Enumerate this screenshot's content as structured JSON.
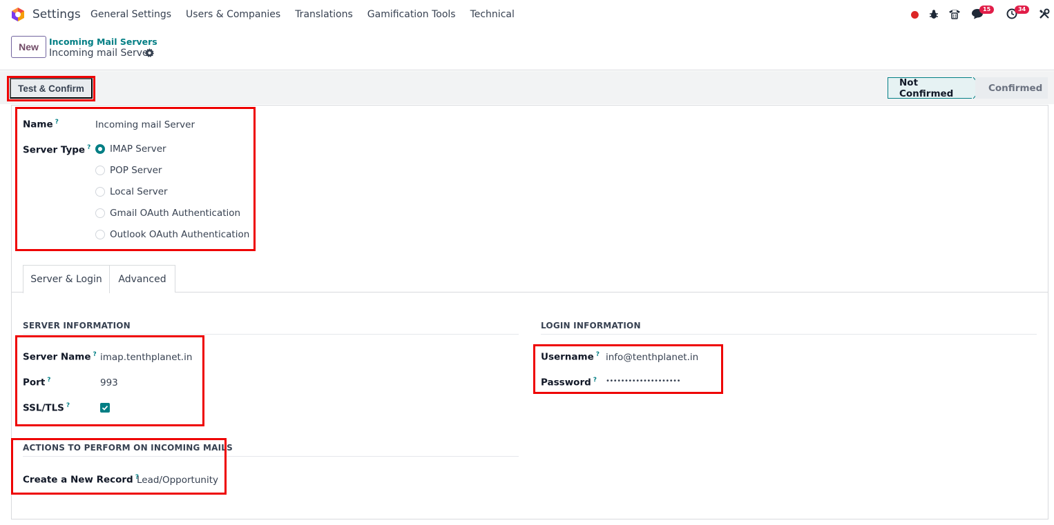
{
  "nav": {
    "app": "Settings",
    "menu": [
      "General Settings",
      "Users & Companies",
      "Translations",
      "Gamification Tools",
      "Technical"
    ],
    "messages_count": "15",
    "activities_count": "34"
  },
  "control_panel": {
    "new_label": "New",
    "breadcrumb_parent": "Incoming Mail Servers",
    "breadcrumb_current": "Incoming mail Server"
  },
  "statusbar": {
    "test_button": "Test & Confirm",
    "stages": [
      "Not Confirmed",
      "Confirmed"
    ],
    "current_stage": "Not Confirmed"
  },
  "form": {
    "name_label": "Name",
    "name_value": "Incoming mail Server",
    "server_type_label": "Server Type",
    "server_types": [
      "IMAP Server",
      "POP Server",
      "Local Server",
      "Gmail OAuth Authentication",
      "Outlook OAuth Authentication"
    ],
    "selected_server_type": "IMAP Server",
    "help_mark": "?"
  },
  "tabs": [
    "Server & Login",
    "Advanced"
  ],
  "server_info": {
    "title": "SERVER INFORMATION",
    "server_name_label": "Server Name",
    "server_name": "imap.tenthplanet.in",
    "port_label": "Port",
    "port": "993",
    "ssl_label": "SSL/TLS",
    "ssl_checked": true
  },
  "login_info": {
    "title": "LOGIN INFORMATION",
    "username_label": "Username",
    "username": "info@tenthplanet.in",
    "password_label": "Password",
    "password": "••••••••••••••••••••"
  },
  "actions": {
    "title": "ACTIONS TO PERFORM ON INCOMING MAILS",
    "create_label": "Create a New Record",
    "create_value": "Lead/Opportunity"
  },
  "colors": {
    "accent": "#017e84",
    "brand": "#714b67",
    "highlight": "#e00000"
  }
}
